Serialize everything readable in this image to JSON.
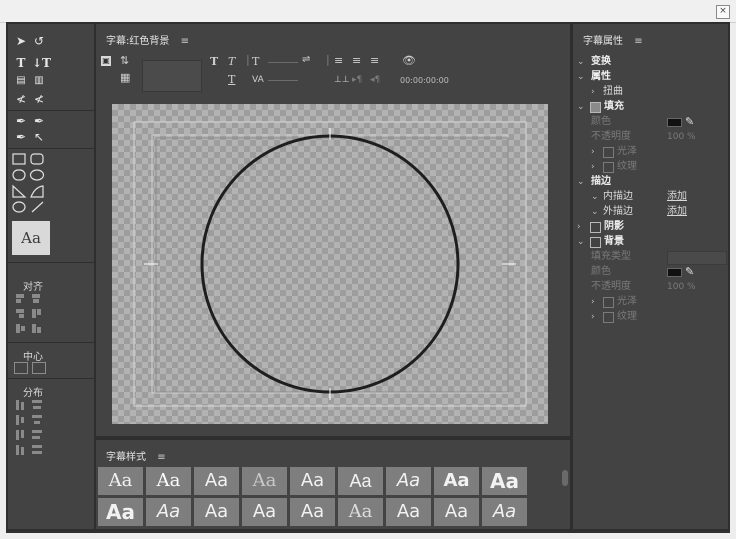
{
  "window": {
    "close_symbol": "×"
  },
  "tools": {
    "align_label": "对齐",
    "center_label": "中心",
    "distribute_label": "分布",
    "style_preview": "Aa"
  },
  "main": {
    "title": "字幕:红色背景",
    "timecode": "00:00:00:00"
  },
  "canvas": {
    "shape": "circle",
    "stroke_color": "#1e1e1e",
    "checker_light": "#b3b3b3",
    "checker_dark": "#9d9d9d"
  },
  "styles": {
    "title": "字幕样式",
    "swatches": [
      "Aa",
      "Aa",
      "Aa",
      "Aa",
      "Aa",
      "Aa",
      "Aa",
      "Aa",
      "Aa",
      "Aa",
      "Aa",
      "Aa",
      "Aa",
      "Aa",
      "Aa",
      "Aa",
      "Aa",
      "Aa"
    ]
  },
  "props": {
    "title": "字幕属性",
    "transform": "变换",
    "attributes": "属性",
    "distort": "扭曲",
    "fill": "填充",
    "fill_color_label": "颜色",
    "fill_opacity_label": "不透明度",
    "fill_opacity_value": "100 %",
    "gloss": "光泽",
    "texture": "纹理",
    "stroke": "描边",
    "inner_stroke": "内描边",
    "outer_stroke": "外描边",
    "add_link": "添加",
    "shadow": "阴影",
    "background": "背景",
    "bg_fill_type_label": "填充类型",
    "bg_color_label": "颜色",
    "bg_opacity_label": "不透明度",
    "bg_opacity_value": "100 %",
    "bg_gloss": "光泽",
    "bg_texture": "纹理",
    "menu_symbol": "≡"
  }
}
